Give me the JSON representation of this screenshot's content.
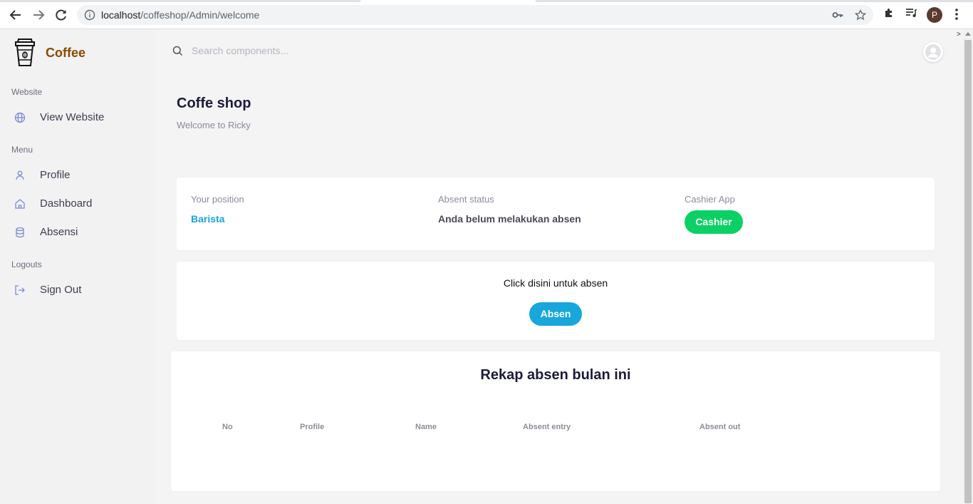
{
  "browser": {
    "url_host": "localhost",
    "url_path": "/coffeshop/Admin/welcome",
    "profile_initial": "P"
  },
  "sidebar": {
    "brand": "Coffee",
    "sections": {
      "website": "Website",
      "menu": "Menu",
      "logouts": "Logouts"
    },
    "items": {
      "view_website": "View Website",
      "profile": "Profile",
      "dashboard": "Dashboard",
      "absensi": "Absensi",
      "sign_out": "Sign Out"
    }
  },
  "search": {
    "placeholder": "Search components..."
  },
  "header": {
    "title": "Coffe shop",
    "subtitle": "Welcome to Ricky"
  },
  "info_card": {
    "position_label": "Your position",
    "position_value": "Barista",
    "absent_label": "Absent status",
    "absent_value": "Anda belum melakukan absen",
    "cashier_label": "Cashier App",
    "cashier_button": "Cashier"
  },
  "absen_card": {
    "text": "Click disini untuk absen",
    "button": "Absen"
  },
  "rekap": {
    "title": "Rekap absen bulan ini",
    "columns": [
      "No",
      "Profile",
      "Name",
      "Absent entry",
      "Absent out"
    ]
  },
  "colors": {
    "brand": "#8a4a00",
    "accent_blue": "#17a7dc",
    "accent_green": "#0bd065",
    "title": "#1c1b3a"
  }
}
